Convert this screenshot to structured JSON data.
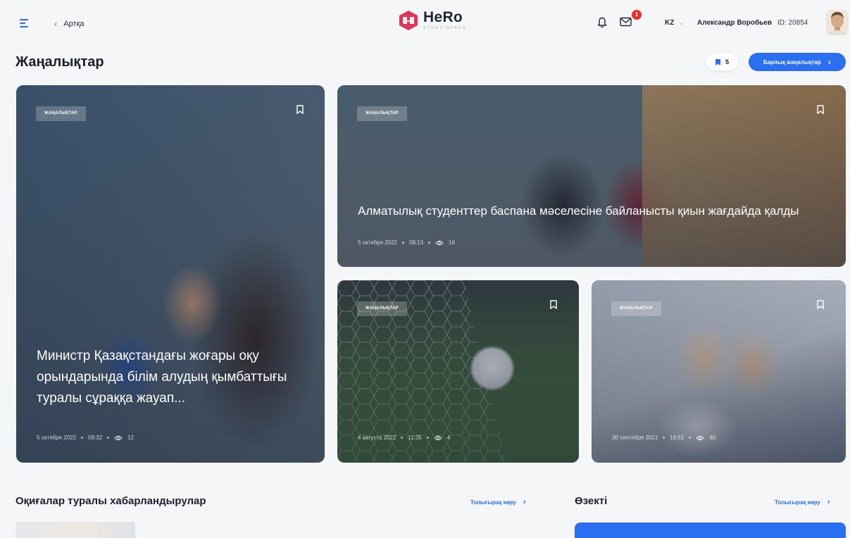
{
  "header": {
    "back_label": "Артқа",
    "logo_title": "HeRo",
    "logo_subtitle": "STUDY SPACE",
    "mail_badge": "1",
    "lang": "KZ",
    "user_name": "Александр Воробьев",
    "user_id": "ID: 20854"
  },
  "news": {
    "title": "Жаңалықтар",
    "bookmark_count": "5",
    "all_news_label": "Барлық жаңалықтар",
    "cards": [
      {
        "tag": "ЖАҢАЛЫҚТАР",
        "title": "Министр Қазақстандағы жоғары оқу орындарында білім алудың қымбаттығы туралы сұраққа жауап...",
        "date": "5 октября 2022",
        "time": "09:32",
        "views": "12"
      },
      {
        "tag": "ЖАҢАЛЫҚТАР",
        "title": "Алматылық студенттер баспана мәселесіне байланысты қиын жағдайда қалды",
        "date": "5 октября 2022",
        "time": "08:13",
        "views": "16"
      },
      {
        "tag": "ЖАҢАЛЫҚТАР",
        "title": "",
        "date": "4 августа 2022",
        "time": "11:35",
        "views": "4"
      },
      {
        "tag": "ЖАҢАЛЫҚТАР",
        "title": "",
        "date": "30 сентября 2021",
        "time": "16:51",
        "views": "40"
      }
    ]
  },
  "events": {
    "title": "Оқиғалар туралы хабарландырулар",
    "more_label": "Толығырақ көру"
  },
  "hot": {
    "title": "Өзекті",
    "more_label": "Толығырақ көру"
  },
  "colors": {
    "accent": "#2a6ff0",
    "badge": "#e4322b",
    "logo": "#e0355a"
  }
}
